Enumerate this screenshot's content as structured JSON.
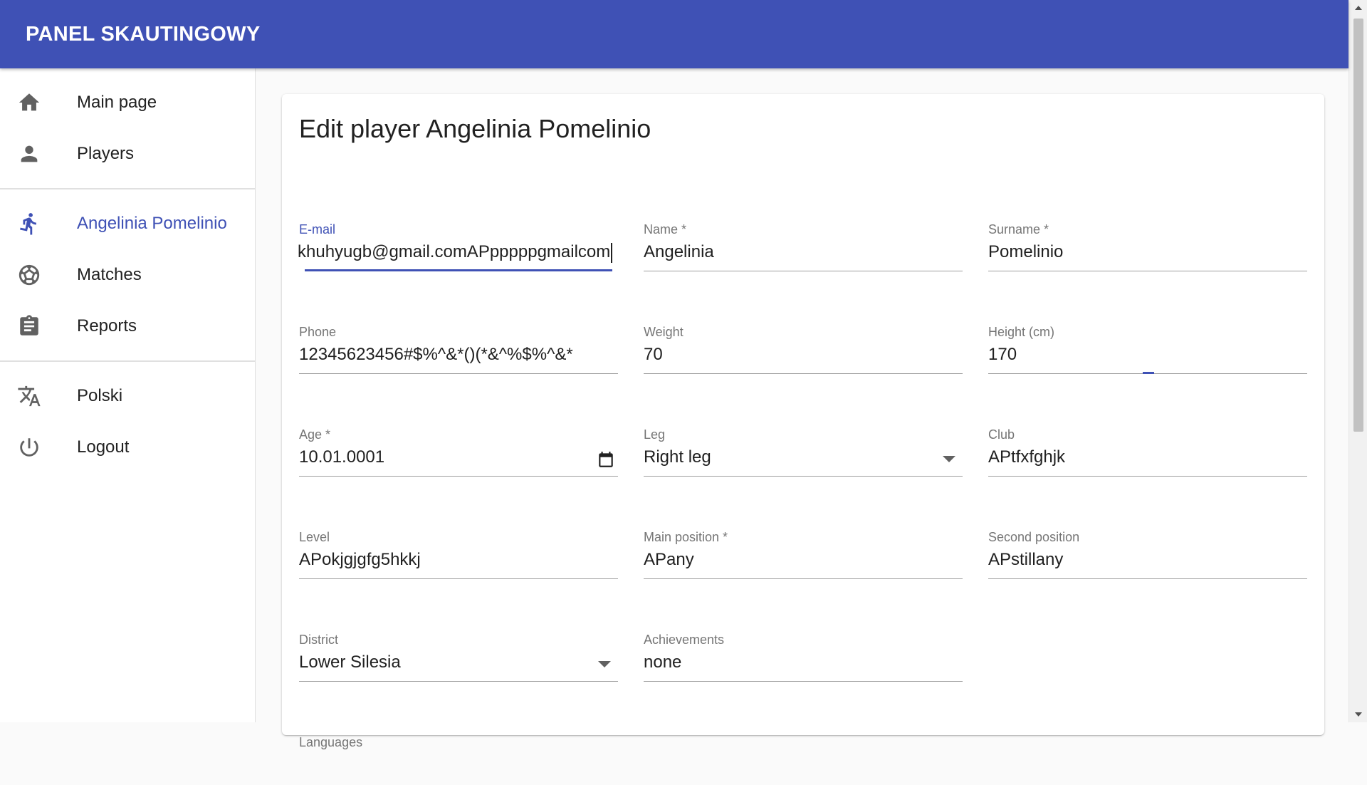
{
  "appbar": {
    "title": "PANEL SKAUTINGOWY"
  },
  "sidebar": {
    "items": [
      {
        "label": "Main page",
        "icon": "home-icon"
      },
      {
        "label": "Players",
        "icon": "person-icon"
      },
      {
        "label": "Angelinia Pomelinio",
        "icon": "running-icon",
        "active": true
      },
      {
        "label": "Matches",
        "icon": "soccer-ball-icon"
      },
      {
        "label": "Reports",
        "icon": "clipboard-icon"
      },
      {
        "label": "Polski",
        "icon": "translate-icon"
      },
      {
        "label": "Logout",
        "icon": "power-icon"
      }
    ]
  },
  "colors": {
    "primary": "#3f51b5",
    "text": "#212121",
    "muted": "#757575"
  },
  "form": {
    "title": "Edit player Angelinia Pomelinio",
    "email": {
      "label": "E-mail",
      "value": "khuhyugb@gmail.comAPpppppgmailcom"
    },
    "name": {
      "label": "Name *",
      "value": "Angelinia"
    },
    "surname": {
      "label": "Surname *",
      "value": "Pomelinio"
    },
    "phone": {
      "label": "Phone",
      "value": "12345623456#$%^&*()(*&^%$%^&*"
    },
    "weight": {
      "label": "Weight",
      "value": "70"
    },
    "height": {
      "label": "Height (cm)",
      "value": "170"
    },
    "age": {
      "label": "Age *",
      "value": "10.01.0001"
    },
    "leg": {
      "label": "Leg",
      "value": "Right leg"
    },
    "club": {
      "label": "Club",
      "value": "APtfxfghjk"
    },
    "level": {
      "label": "Level",
      "value": "APokjgjgfg5hkkj"
    },
    "main_position": {
      "label": "Main position *",
      "value": "APany"
    },
    "second_position": {
      "label": "Second position",
      "value": "APstillany"
    },
    "district": {
      "label": "District",
      "value": "Lower Silesia"
    },
    "achievements": {
      "label": "Achievements",
      "value": "none"
    },
    "languages": {
      "label": "Languages"
    }
  }
}
